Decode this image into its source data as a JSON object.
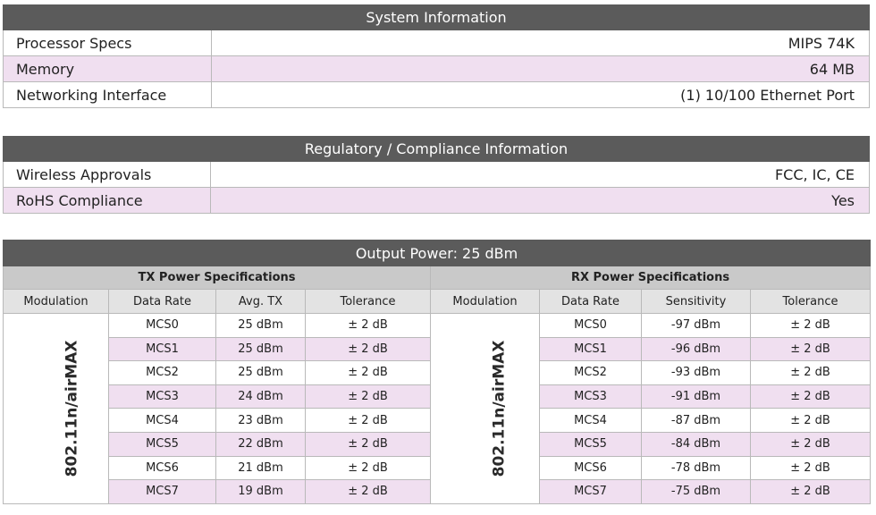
{
  "system": {
    "title": "System Information",
    "rows": [
      {
        "label": "Processor Specs",
        "value": "MIPS 74K"
      },
      {
        "label": "Memory",
        "value": "64 MB"
      },
      {
        "label": "Networking Interface",
        "value": "(1) 10/100 Ethernet Port"
      }
    ]
  },
  "regulatory": {
    "title": "Regulatory / Compliance Information",
    "rows": [
      {
        "label": "Wireless Approvals",
        "value": "FCC, IC, CE"
      },
      {
        "label": "RoHS Compliance",
        "value": "Yes"
      }
    ]
  },
  "power": {
    "title": "Output Power: 25 dBm",
    "tx": {
      "title": "TX Power Specifications",
      "headers": [
        "Modulation",
        "Data Rate",
        "Avg. TX",
        "Tolerance"
      ],
      "modulation": "802.11n/airMAX",
      "rows": [
        {
          "rate": "MCS0",
          "val": "25 dBm",
          "tol": "± 2 dB"
        },
        {
          "rate": "MCS1",
          "val": "25 dBm",
          "tol": "± 2 dB"
        },
        {
          "rate": "MCS2",
          "val": "25 dBm",
          "tol": "± 2 dB"
        },
        {
          "rate": "MCS3",
          "val": "24 dBm",
          "tol": "± 2 dB"
        },
        {
          "rate": "MCS4",
          "val": "23 dBm",
          "tol": "± 2 dB"
        },
        {
          "rate": "MCS5",
          "val": "22 dBm",
          "tol": "± 2 dB"
        },
        {
          "rate": "MCS6",
          "val": "21 dBm",
          "tol": "± 2 dB"
        },
        {
          "rate": "MCS7",
          "val": "19 dBm",
          "tol": "± 2 dB"
        }
      ]
    },
    "rx": {
      "title": "RX Power Specifications",
      "headers": [
        "Modulation",
        "Data Rate",
        "Sensitivity",
        "Tolerance"
      ],
      "modulation": "802.11n/airMAX",
      "rows": [
        {
          "rate": "MCS0",
          "val": "-97 dBm",
          "tol": "± 2 dB"
        },
        {
          "rate": "MCS1",
          "val": "-96 dBm",
          "tol": "± 2 dB"
        },
        {
          "rate": "MCS2",
          "val": "-93 dBm",
          "tol": "± 2 dB"
        },
        {
          "rate": "MCS3",
          "val": "-91 dBm",
          "tol": "± 2 dB"
        },
        {
          "rate": "MCS4",
          "val": "-87 dBm",
          "tol": "± 2 dB"
        },
        {
          "rate": "MCS5",
          "val": "-84 dBm",
          "tol": "± 2 dB"
        },
        {
          "rate": "MCS6",
          "val": "-78 dBm",
          "tol": "± 2 dB"
        },
        {
          "rate": "MCS7",
          "val": "-75 dBm",
          "tol": "± 2 dB"
        }
      ]
    }
  }
}
